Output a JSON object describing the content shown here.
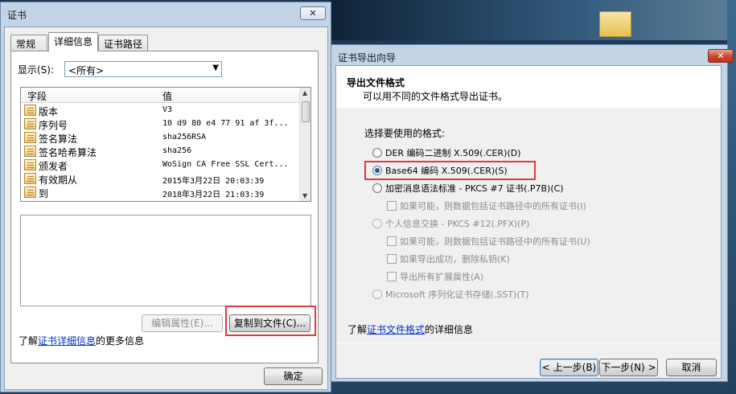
{
  "cert_window": {
    "title": "证书",
    "tabs": [
      "常规",
      "详细信息",
      "证书路径"
    ],
    "show_label": "显示(S):",
    "show_value": "<所有>",
    "columns": {
      "field": "字段",
      "value": "值"
    },
    "rows": [
      {
        "field": "版本",
        "value": "V3"
      },
      {
        "field": "序列号",
        "value": "10 d9 80 e4 77 91 af 3f..."
      },
      {
        "field": "签名算法",
        "value": "sha256RSA"
      },
      {
        "field": "签名哈希算法",
        "value": "sha256"
      },
      {
        "field": "颁发者",
        "value": "WoSign CA Free SSL Cert..."
      },
      {
        "field": "有效期从",
        "value": "2015年3月22日 20:03:39"
      },
      {
        "field": "到",
        "value": "2018年3月22日 21:03:39"
      }
    ],
    "edit_props_button": "编辑属性(E)...",
    "copy_to_file_button": "复制到文件(C)...",
    "info_prefix": "了解",
    "info_link": "证书详细信息",
    "info_suffix": "的更多信息",
    "ok_button": "确定"
  },
  "wizard": {
    "title": "证书导出向导",
    "heading": "导出文件格式",
    "subheading": "可以用不同的文件格式导出证书。",
    "choose_label": "选择要使用的格式:",
    "options": [
      {
        "label": "DER 编码二进制 X.509(.CER)(D)",
        "state": "unselected"
      },
      {
        "label": "Base64 编码 X.509(.CER)(S)",
        "state": "selected"
      },
      {
        "label": "加密消息语法标准 - PKCS #7 证书(.P7B)(C)",
        "state": "unselected"
      },
      {
        "label": "如果可能，则数据包括证书路径中的所有证书(I)",
        "state": "disabled"
      },
      {
        "label": "个人信息交换 - PKCS #12(.PFX)(P)",
        "state": "disabled"
      },
      {
        "label": "如果可能，则数据包括证书路径中的所有证书(U)",
        "state": "disabled"
      },
      {
        "label": "如果导出成功，删除私钥(K)",
        "state": "disabled"
      },
      {
        "label": "导出所有扩展属性(A)",
        "state": "disabled"
      },
      {
        "label": "Microsoft 序列化证书存储(.SST)(T)",
        "state": "disabled"
      }
    ],
    "learn_prefix": "了解",
    "learn_link": "证书文件格式",
    "learn_suffix": "的详细信息",
    "back_button": "< 上一步(B)",
    "next_button": "下一步(N) >",
    "cancel_button": "取消"
  },
  "colors": {
    "highlight_box": "#e23b3b",
    "link": "#0033cc",
    "window_frame": "#c3d4e7"
  }
}
